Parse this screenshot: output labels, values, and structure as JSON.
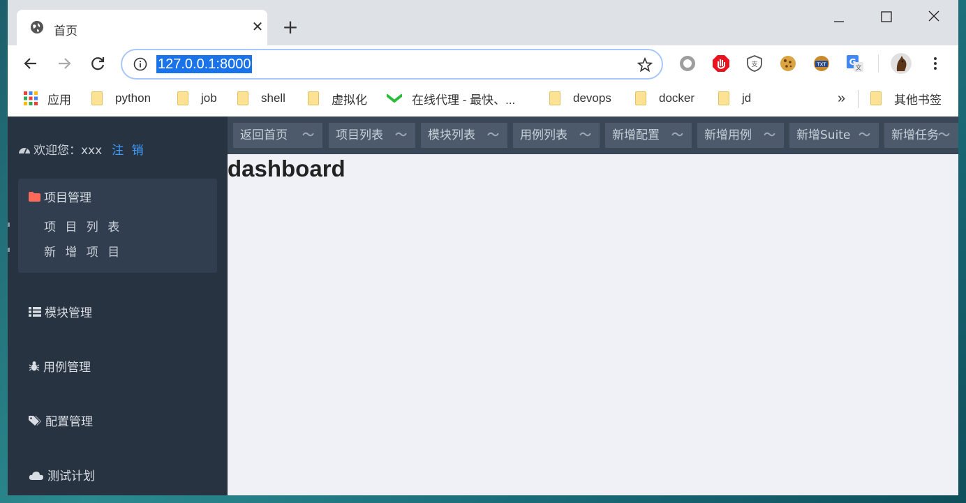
{
  "browser": {
    "tab_title": "首页",
    "tab_close": "✕",
    "new_tab": "+",
    "url": "127.0.0.1:8000"
  },
  "bookmarks": [
    {
      "label": "应用",
      "icon": "apps-grid-icon"
    },
    {
      "label": "python",
      "icon": "folder-icon"
    },
    {
      "label": "job",
      "icon": "folder-icon"
    },
    {
      "label": "shell",
      "icon": "folder-icon"
    },
    {
      "label": "虚拟化",
      "icon": "folder-icon"
    },
    {
      "label": "在线代理 - 最快、...",
      "icon": "green-check-icon"
    },
    {
      "label": "devops",
      "icon": "folder-icon"
    },
    {
      "label": "docker",
      "icon": "folder-icon"
    },
    {
      "label": "jd",
      "icon": "folder-icon"
    }
  ],
  "bookmarks_overflow": "»",
  "other_bookmarks": "其他书签",
  "sidebar": {
    "welcome": "欢迎您：xxx",
    "logout": "注 销",
    "project_group": {
      "title": "项目管理",
      "items": [
        "项 目 列 表",
        "新 增 项 目"
      ]
    },
    "menus": [
      "模块管理",
      "用例管理",
      "配置管理",
      "测试计划"
    ]
  },
  "content_tabs": [
    {
      "label": "返回首页"
    },
    {
      "label": "项目列表"
    },
    {
      "label": "模块列表"
    },
    {
      "label": "用例列表"
    },
    {
      "label": "新增配置"
    },
    {
      "label": "新增用例"
    },
    {
      "label": "新增Suite"
    },
    {
      "label": "新增任务"
    }
  ],
  "tab_tilde": "～",
  "main": {
    "title": "dashboard"
  },
  "colors": {
    "sidebar_bg": "#283342",
    "accent_link": "#3d9dff",
    "folder_icon": "#fd6a5a",
    "selection": "#1a73e8"
  }
}
